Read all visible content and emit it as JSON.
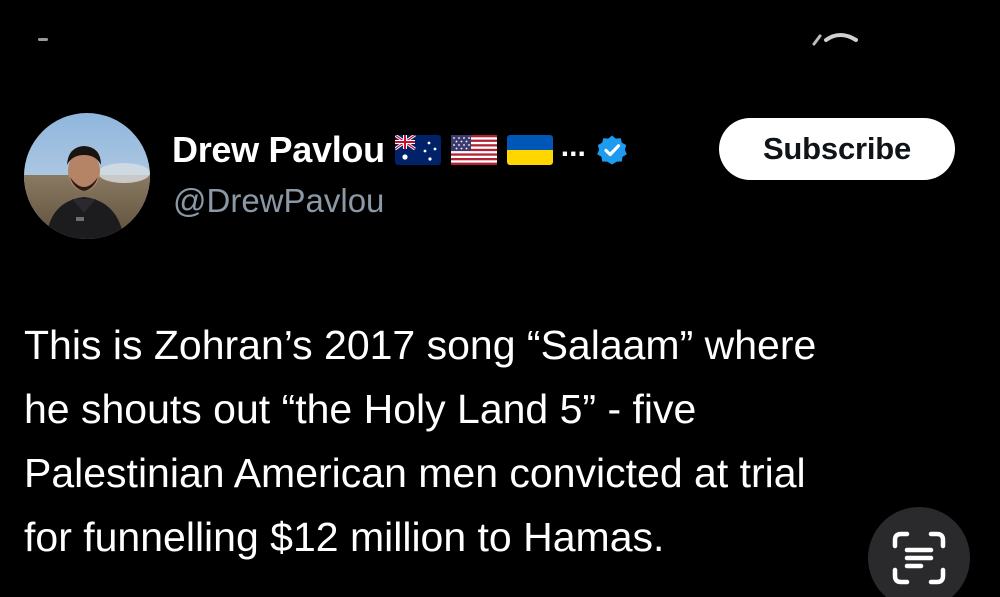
{
  "account": {
    "display_name": "Drew Pavlou",
    "handle": "@DrewPavlou",
    "more_label": "...",
    "flags": [
      "australia-flag",
      "usa-flag",
      "ukraine-flag"
    ],
    "verified_color": "#1d9bf0"
  },
  "actions": {
    "subscribe_label": "Subscribe"
  },
  "tweet": {
    "lines": [
      "This is Zohran’s 2017 song “Salaam” where",
      "he shouts out “the Holy Land 5” - five",
      "Palestinian American men convicted at trial",
      "for funnelling $12 million to Hamas."
    ]
  },
  "icons": {
    "live_text": "live-text-icon"
  },
  "colors": {
    "background": "#000000",
    "primary_text": "#ffffff",
    "secondary_text": "#8b98a5",
    "button_bg": "#ffffff",
    "button_text": "#0f1419"
  }
}
